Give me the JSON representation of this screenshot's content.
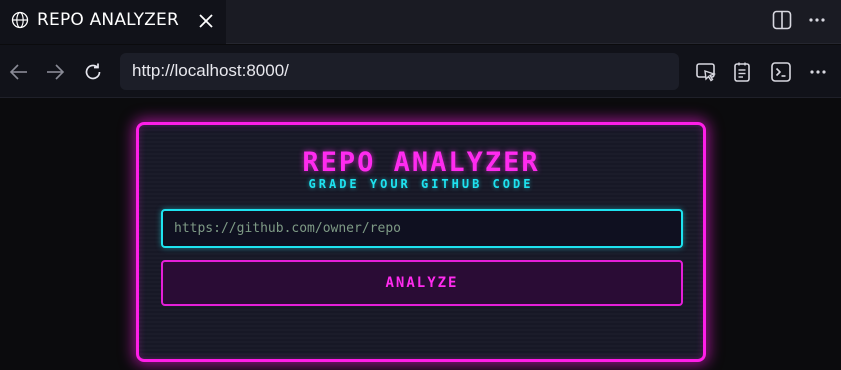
{
  "browser": {
    "tab": {
      "title": "REPO ANALYZER",
      "icon": "globe-icon",
      "close_icon": "close-icon"
    },
    "toolbar_icons": [
      "split-screen-icon",
      "more-options-icon"
    ],
    "address_bar": {
      "url": "http://localhost:8000/"
    },
    "nav_icons": [
      "back-arrow-icon",
      "forward-arrow-icon",
      "reload-icon"
    ],
    "right_icons": [
      "cast-icon",
      "reading-list-icon",
      "terminal-icon",
      "more-options-icon"
    ]
  },
  "app": {
    "title": "REPO ANALYZER",
    "subtitle": "GRADE YOUR GITHUB CODE",
    "input": {
      "placeholder": "https://github.com/owner/repo",
      "value": ""
    },
    "analyze_label": "ANALYZE"
  },
  "colors": {
    "accent_pink": "#ff1ee8",
    "accent_cyan": "#1ee3f0",
    "background": "#0b0b0d"
  }
}
